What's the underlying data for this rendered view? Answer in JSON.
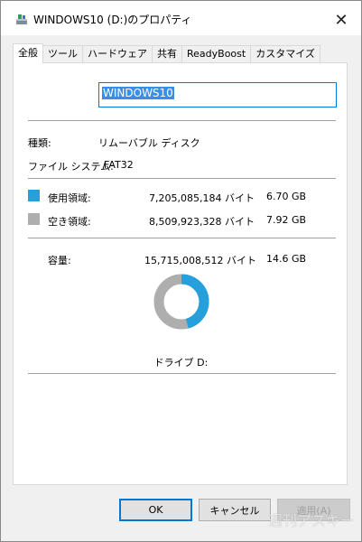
{
  "window": {
    "title": "WINDOWS10 (D:)のプロパティ",
    "icon": "removable-drive-icon"
  },
  "tabs": [
    "全般",
    "ツール",
    "ハードウェア",
    "共有",
    "ReadyBoost",
    "カスタマイズ"
  ],
  "active_tab": "全般",
  "general": {
    "volume_name": "WINDOWS10",
    "type_label": "種類:",
    "type_value": "リムーバブル ディスク",
    "fs_label": "ファイル システム:",
    "fs_value": "FAT32",
    "used": {
      "label": "使用領域:",
      "bytes": "7,205,085,184 バイト",
      "size": "6.70 GB",
      "color": "#26a0da"
    },
    "free": {
      "label": "空き領域:",
      "bytes": "8,509,923,328 バイト",
      "size": "7.92 GB",
      "color": "#aeaeae"
    },
    "capacity": {
      "label": "容量:",
      "bytes": "15,715,008,512 バイト",
      "size": "14.6 GB"
    },
    "used_fraction": 0.4585,
    "drive_label": "ドライブ D:"
  },
  "buttons": {
    "ok": "OK",
    "cancel": "キャンセル",
    "apply": "適用(A)"
  },
  "watermark": "週刊アスキー"
}
